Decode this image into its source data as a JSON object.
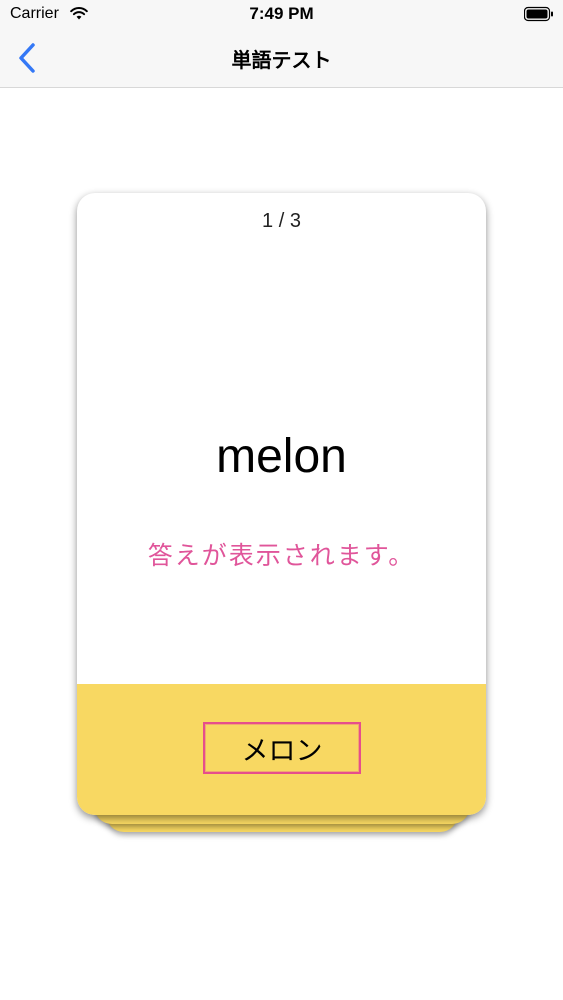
{
  "status_bar": {
    "carrier": "Carrier",
    "time": "7:49 PM",
    "wifi_icon": "wifi-icon",
    "battery_icon": "battery-icon"
  },
  "nav": {
    "title": "単語テスト",
    "back_icon": "chevron-left-icon"
  },
  "card": {
    "counter": "1 / 3",
    "word": "melon",
    "hint": "答えが表示されます。",
    "answer_button_label": "メロン"
  },
  "colors": {
    "accent_blue": "#3478f6",
    "card_yellow": "#f8d862",
    "hint_pink": "#e0559a",
    "button_border": "#e64e8c"
  }
}
